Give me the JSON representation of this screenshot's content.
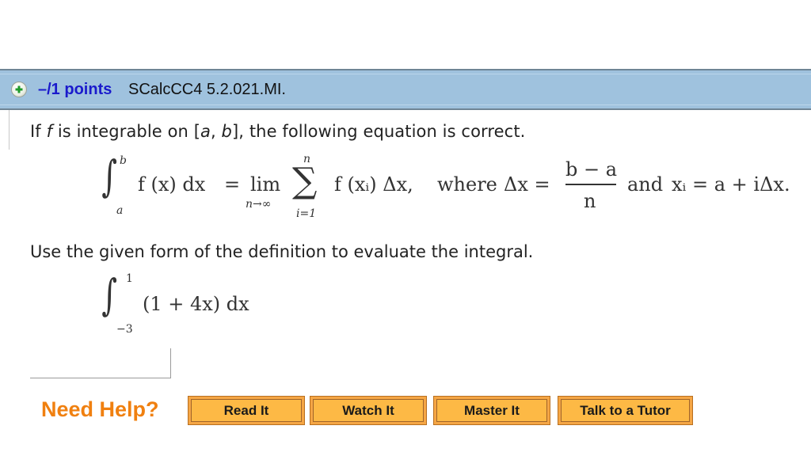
{
  "question_header": {
    "expand_icon": "plus-circle-icon",
    "points": "–/1 points",
    "question_id": "SCalcCC4 5.2.021.MI."
  },
  "problem": {
    "intro_parts": [
      "If ",
      "f",
      " is integrable on [",
      "a",
      ", ",
      "b",
      "], the following equation is correct."
    ],
    "definition": {
      "integral_upper": "b",
      "integral_lower": "a",
      "integrand": "f (x) dx",
      "equals": "=",
      "lim": "lim",
      "lim_sub": "n→∞",
      "sum_upper": "n",
      "sum_lower": "i=1",
      "summand": "f (xᵢ) Δx,",
      "where": "where",
      "delta_lhs": "Δx =",
      "frac_num": "b − a",
      "frac_den": "n",
      "and": "and",
      "xi_def": "xᵢ = a + iΔx."
    },
    "instruction": "Use the given form of the definition to evaluate the integral.",
    "integral": {
      "upper": "1",
      "lower": "−3",
      "integrand": "(1 + 4x) dx"
    },
    "answer_value": ""
  },
  "help": {
    "label": "Need Help?",
    "buttons": [
      "Read It",
      "Watch It",
      "Master It",
      "Talk to a Tutor"
    ]
  }
}
